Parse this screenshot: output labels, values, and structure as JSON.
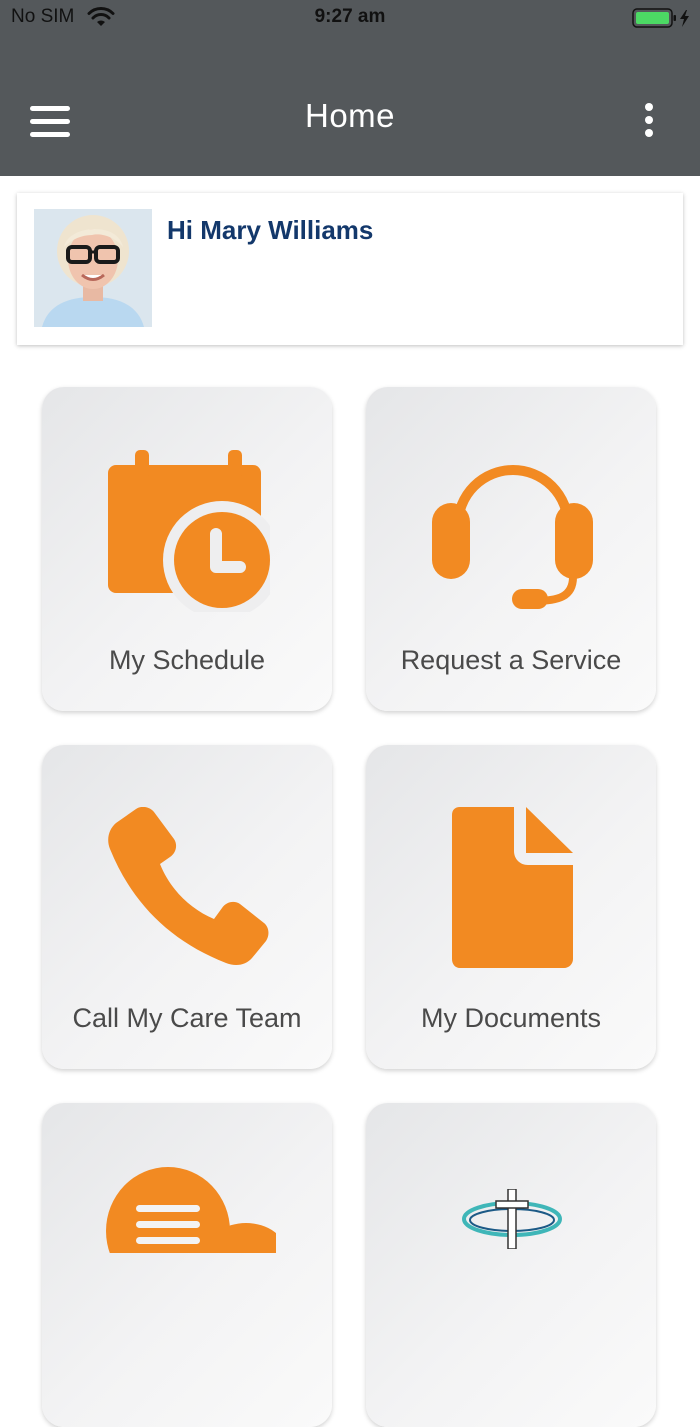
{
  "status_bar": {
    "carrier": "No SIM",
    "time": "9:27 am"
  },
  "header": {
    "title": "Home"
  },
  "profile": {
    "greeting": "Hi Mary Williams"
  },
  "tiles": [
    {
      "label": "My Schedule",
      "icon": "calendar-clock-icon"
    },
    {
      "label": "Request a Service",
      "icon": "headset-icon"
    },
    {
      "label": "Call My Care Team",
      "icon": "phone-icon"
    },
    {
      "label": "My Documents",
      "icon": "document-icon"
    },
    {
      "label": "",
      "icon": "chat-bubble-icon"
    },
    {
      "label": "",
      "icon": "cross-logo-icon"
    }
  ],
  "colors": {
    "header_bg": "#54585b",
    "accent": "#f28a22",
    "greeting_text": "#13386b",
    "tile_label": "#4a4a4a",
    "battery": "#4cd964"
  }
}
